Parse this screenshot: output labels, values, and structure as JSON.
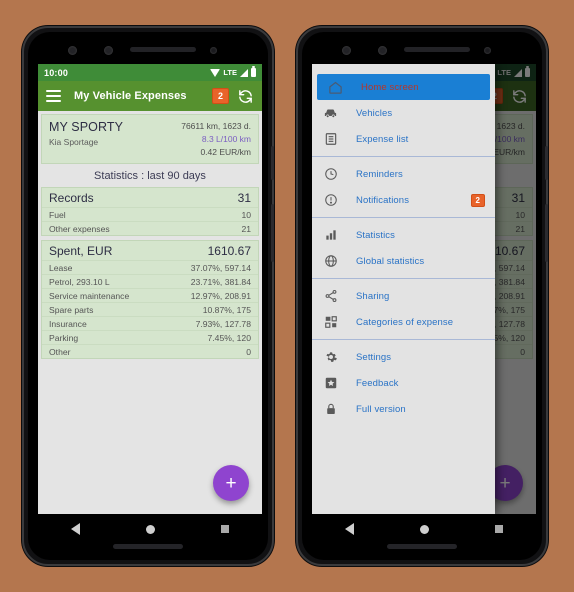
{
  "background_color": "#b4764e",
  "status_bar": {
    "time": "10:00",
    "network_label": "LTE",
    "icons": [
      "wifi-icon",
      "signal-icon",
      "battery-icon"
    ]
  },
  "toolbar": {
    "title": "My Vehicle Expenses",
    "menu_icon": "hamburger-menu-icon",
    "badge_count": "2",
    "refresh_icon": "refresh-sync-icon",
    "background_color": "#56912f"
  },
  "vehicle_card": {
    "name": "MY SPORTY",
    "model": "Kia Sportage",
    "odometer": "76611 km, 1623 d.",
    "consumption": "8.3 L/100 km",
    "consumption_color": "#7b5ec2",
    "cost_per_km": "0.42 EUR/km"
  },
  "statistics_header": "Statistics : last 90 days",
  "records_group": {
    "title": "Records",
    "total": "31",
    "rows": [
      {
        "label": "Fuel",
        "value": "10"
      },
      {
        "label": "Other expenses",
        "value": "21"
      }
    ]
  },
  "spent_group": {
    "title": "Spent, EUR",
    "total": "1610.67",
    "rows": [
      {
        "label": "Lease",
        "value": "37.07%, 597.14"
      },
      {
        "label": "Petrol, 293.10 L",
        "value": "23.71%, 381.84"
      },
      {
        "label": "Service maintenance",
        "value": "12.97%, 208.91"
      },
      {
        "label": "Spare parts",
        "value": "10.87%, 175"
      },
      {
        "label": "Insurance",
        "value": "7.93%, 127.78"
      },
      {
        "label": "Parking",
        "value": "7.45%, 120"
      },
      {
        "label": "Other",
        "value": "0"
      }
    ]
  },
  "fab": {
    "icon": "plus-icon",
    "label": "+",
    "color": "#8f44cf"
  },
  "navigation_bar": {
    "back": "back-triangle-icon",
    "home": "home-circle-icon",
    "recents": "recents-square-icon"
  },
  "drawer": {
    "sections": [
      {
        "items": [
          {
            "label": "Home screen",
            "icon": "home-outline-icon",
            "active": true
          },
          {
            "label": "Vehicles",
            "icon": "car-icon",
            "active": false
          },
          {
            "label": "Expense list",
            "icon": "list-document-icon",
            "active": false
          }
        ]
      },
      {
        "items": [
          {
            "label": "Reminders",
            "icon": "clock-icon",
            "active": false
          },
          {
            "label": "Notifications",
            "icon": "exclamation-circle-icon",
            "active": false,
            "badge": "2"
          }
        ]
      },
      {
        "items": [
          {
            "label": "Statistics",
            "icon": "bar-chart-icon",
            "active": false
          },
          {
            "label": "Global statistics",
            "icon": "globe-icon",
            "active": false
          }
        ]
      },
      {
        "items": [
          {
            "label": "Sharing",
            "icon": "share-nodes-icon",
            "active": false
          },
          {
            "label": "Categories of expense",
            "icon": "grid-categories-icon",
            "active": false
          }
        ]
      },
      {
        "items": [
          {
            "label": "Settings",
            "icon": "gear-icon",
            "active": false
          },
          {
            "label": "Feedback",
            "icon": "star-box-icon",
            "active": false
          },
          {
            "label": "Full version",
            "icon": "lock-icon",
            "active": false
          }
        ]
      }
    ],
    "active_item_bg": "#1a7fd4",
    "active_item_text": "#b5372b",
    "item_text_color": "#2a73c6"
  }
}
